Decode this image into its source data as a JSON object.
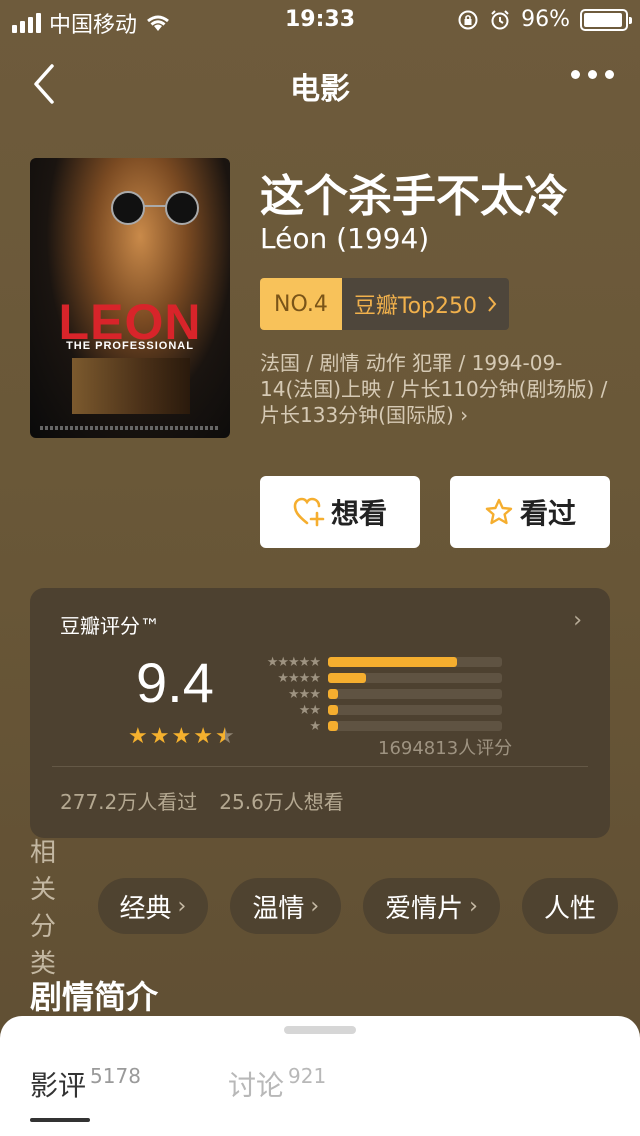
{
  "status_bar": {
    "carrier": "中国移动",
    "time": "19:33",
    "battery": "96%",
    "battery_level": 0.96
  },
  "nav": {
    "title": "电影"
  },
  "movie": {
    "title": "这个杀手不太冷",
    "original_title": "Léon (1994)",
    "rank_no": "NO.4",
    "rank_list": "豆瓣Top250",
    "meta": "法国 / 剧情 动作 犯罪 / 1994-09-14(法国)上映 / 片长110分钟(剧场版) / 片长133分钟(国际版)",
    "poster_title": "LEON",
    "poster_subtitle": "THE PROFESSIONAL"
  },
  "actions": {
    "want_label": "想看",
    "seen_label": "看过"
  },
  "rating": {
    "label": "豆瓣评分™",
    "score": "9.4",
    "stars": 4.5,
    "distribution": [
      {
        "stars": 5,
        "fraction": 0.74
      },
      {
        "stars": 4,
        "fraction": 0.22
      },
      {
        "stars": 3,
        "fraction": 0.03
      },
      {
        "stars": 2,
        "fraction": 0.01
      },
      {
        "stars": 1,
        "fraction": 0.01
      }
    ],
    "count": "1694813人评分",
    "watched": "277.2万人看过",
    "want": "25.6万人想看"
  },
  "related": {
    "label": "相关分类",
    "tags": [
      "经典",
      "温情",
      "爱情片",
      "人性"
    ]
  },
  "synopsis": {
    "heading": "剧情简介"
  },
  "sheet": {
    "tabs": [
      {
        "label": "影评",
        "count": "5178"
      },
      {
        "label": "讨论",
        "count": "921"
      }
    ]
  },
  "colors": {
    "accent": "#f5ae2f",
    "background": "#6e5b3c",
    "card": "#4d4130"
  }
}
